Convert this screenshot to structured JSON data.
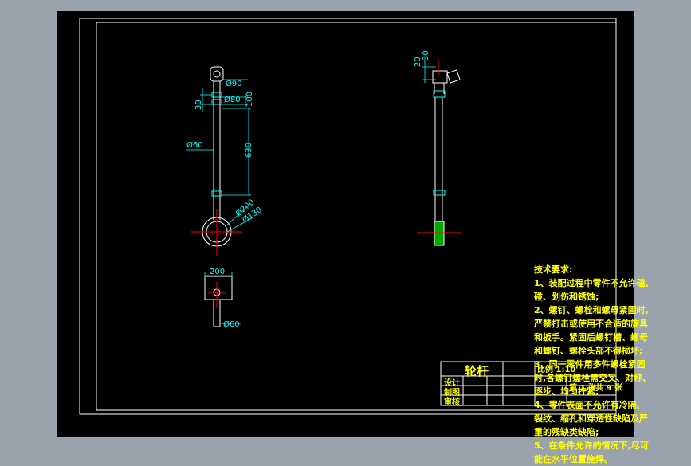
{
  "colors": {
    "sheet": "#000000",
    "frame": "#ffffff",
    "dimension": "#00ffff",
    "annotation": "#ffff00",
    "centerline": "#ff0000",
    "accent_fill": "#00c000"
  },
  "front_view": {
    "dim_d90": "Ø90",
    "dim_d80": "Ø80",
    "dim_30": "30",
    "dim_100": "100",
    "dim_d60": "Ø60",
    "dim_630": "630",
    "dim_d200": "Ø200",
    "dim_d130": "Ø130"
  },
  "side_view": {
    "dim_20": "20",
    "dim_30": "30"
  },
  "bottom_view": {
    "dim_200": "200",
    "dim_d60": "Ø60"
  },
  "tech_notes": {
    "title": "技术要求:",
    "lines": [
      "1、装配过程中零件不允许磕、",
      "碰、划伤和锈蚀;",
      "2、螺钉、螺栓和螺母紧固时,",
      "严禁打击或使用不合适的旋具",
      "和扳手。紧固后螺钉槽、螺母",
      "和螺钉、螺栓头部不得损坏;",
      "3、同一零件用多件螺栓紧固",
      "时,各螺钉螺栓需交叉、对称、",
      "逐步、均匀拧紧;",
      "4、零件表面不允许有冷隔、",
      "裂纹、缩孔和穿透性缺陷及严",
      "重的残缺类缺陷;",
      "5、在条件允许的情况下,尽可",
      "能在水平位置施焊。"
    ]
  },
  "title_block": {
    "part_name": "轮杆",
    "scale": "比例 1:10",
    "role_design": "设计",
    "role_draw": "制图",
    "role_review": "审核",
    "sheet_count": "共 9 张",
    "sheet_no": "第 1 张"
  }
}
